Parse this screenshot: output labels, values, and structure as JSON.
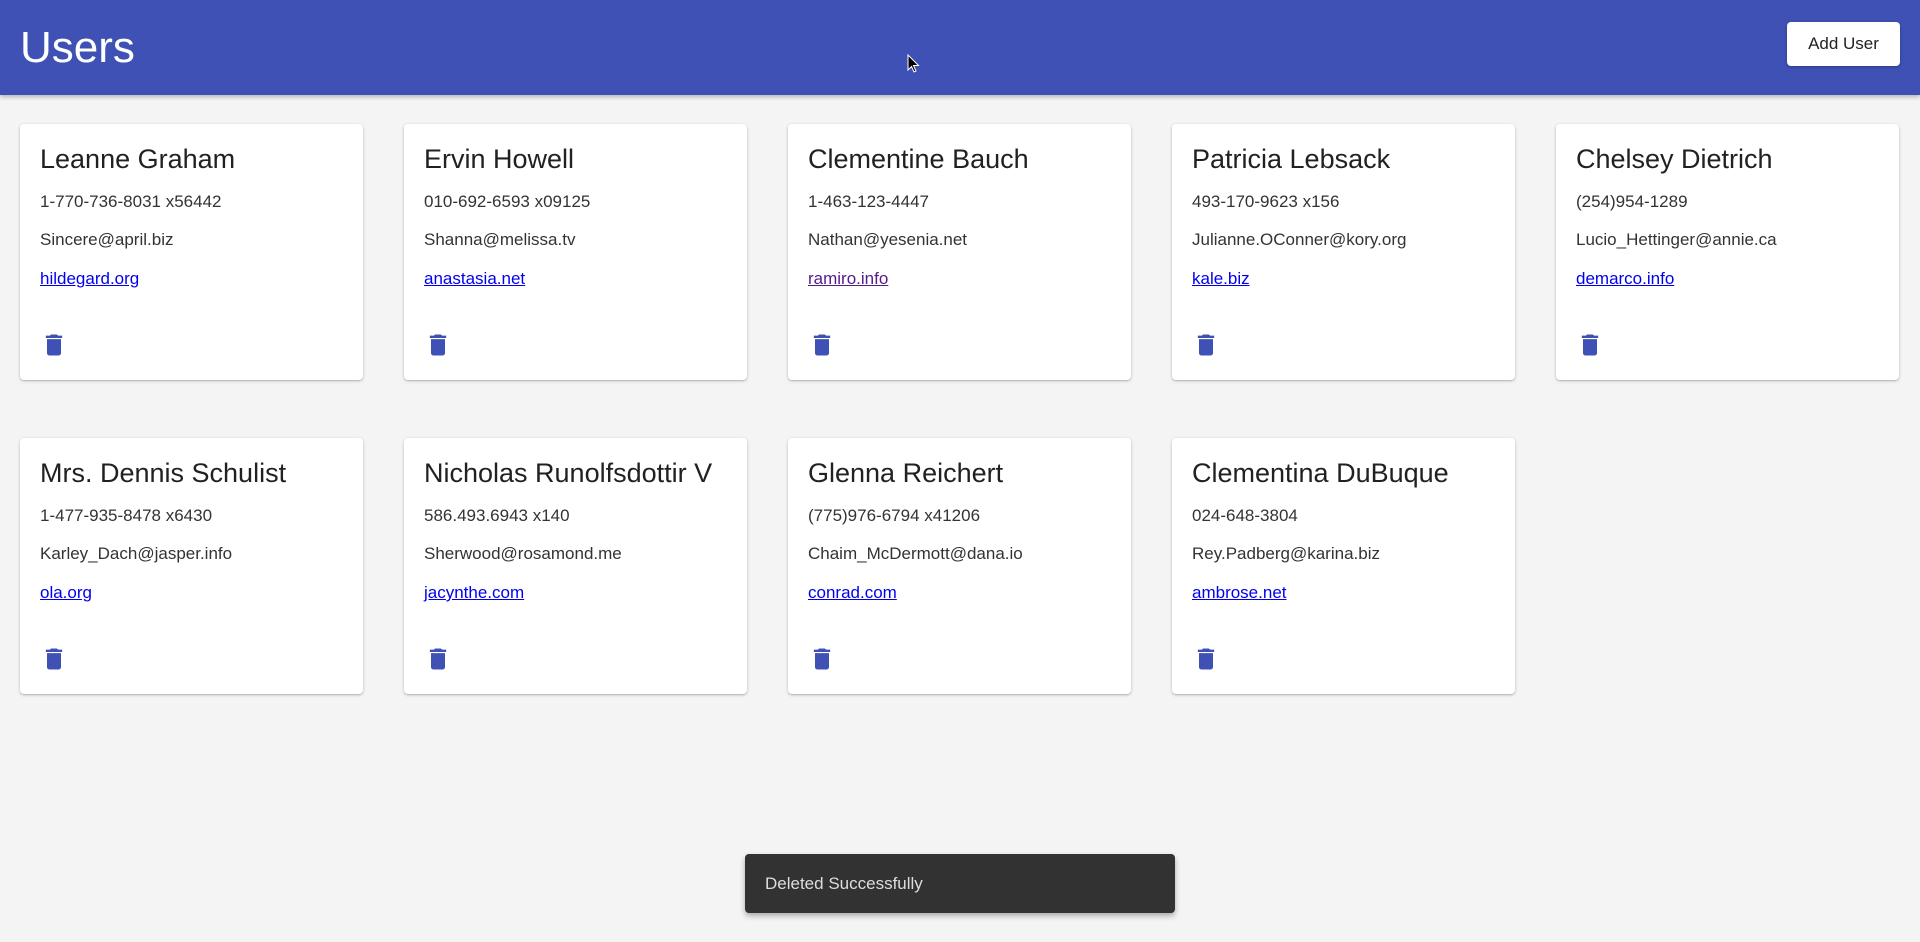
{
  "toolbar": {
    "title": "Users",
    "add_label": "Add User",
    "color": "#3f51b5"
  },
  "users": [
    {
      "name": "Leanne Graham",
      "phone": "1-770-736-8031 x56442",
      "email": "Sincere@april.biz",
      "website": "hildegard.org"
    },
    {
      "name": "Ervin Howell",
      "phone": "010-692-6593 x09125",
      "email": "Shanna@melissa.tv",
      "website": "anastasia.net"
    },
    {
      "name": "Clementine Bauch",
      "phone": "1-463-123-4447",
      "email": "Nathan@yesenia.net",
      "website": "ramiro.info",
      "visited": true
    },
    {
      "name": "Patricia Lebsack",
      "phone": "493-170-9623 x156",
      "email": "Julianne.OConner@kory.org",
      "website": "kale.biz"
    },
    {
      "name": "Chelsey Dietrich",
      "phone": "(254)954-1289",
      "email": "Lucio_Hettinger@annie.ca",
      "website": "demarco.info"
    },
    {
      "name": "Mrs. Dennis Schulist",
      "phone": "1-477-935-8478 x6430",
      "email": "Karley_Dach@jasper.info",
      "website": "ola.org"
    },
    {
      "name": "Nicholas Runolfsdottir V",
      "phone": "586.493.6943 x140",
      "email": "Sherwood@rosamond.me",
      "website": "jacynthe.com"
    },
    {
      "name": "Glenna Reichert",
      "phone": "(775)976-6794 x41206",
      "email": "Chaim_McDermott@dana.io",
      "website": "conrad.com"
    },
    {
      "name": "Clementina DuBuque",
      "phone": "024-648-3804",
      "email": "Rey.Padberg@karina.biz",
      "website": "ambrose.net"
    }
  ],
  "delete_icon": "trash-icon",
  "snackbar": {
    "message": "Deleted Successfully"
  }
}
